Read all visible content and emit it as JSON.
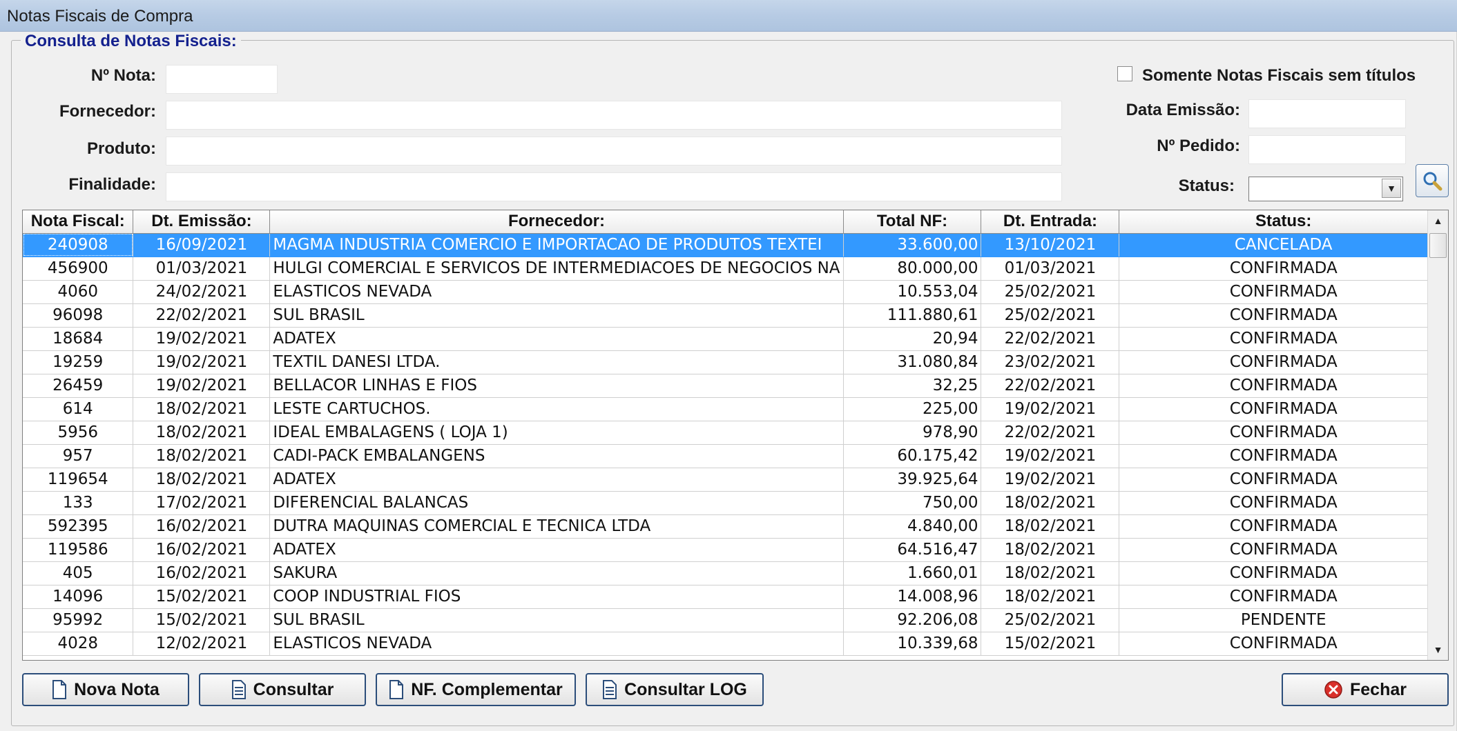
{
  "window": {
    "title": "Notas Fiscais de Compra"
  },
  "group": {
    "legend": "Consulta de Notas Fiscais:"
  },
  "filters": {
    "nota_label": "Nº Nota:",
    "fornecedor_label": "Fornecedor:",
    "produto_label": "Produto:",
    "finalidade_label": "Finalidade:",
    "somente_label": "Somente Notas Fiscais sem títulos",
    "data_emissao_label": "Data Emissão:",
    "pedido_label": "Nº Pedido:",
    "status_label": "Status:",
    "nota_value": "",
    "fornecedor_value": "",
    "produto_value": "",
    "finalidade_value": "",
    "data_emissao_value": "",
    "pedido_value": "",
    "status_value": ""
  },
  "grid": {
    "columns": [
      "Nota Fiscal:",
      "Dt. Emissão:",
      "Fornecedor:",
      "Total NF:",
      "Dt. Entrada:",
      "Status:"
    ],
    "rows": [
      [
        "240908",
        "16/09/2021",
        "MAGMA INDUSTRIA COMERCIO E IMPORTACAO DE PRODUTOS TEXTEI",
        "33.600,00",
        "13/10/2021",
        "CANCELADA"
      ],
      [
        "456900",
        "01/03/2021",
        "HULGI COMERCIAL E SERVICOS DE INTERMEDIACOES DE NEGOCIOS NA",
        "80.000,00",
        "01/03/2021",
        "CONFIRMADA"
      ],
      [
        "4060",
        "24/02/2021",
        "ELASTICOS NEVADA",
        "10.553,04",
        "25/02/2021",
        "CONFIRMADA"
      ],
      [
        "96098",
        "22/02/2021",
        "SUL BRASIL",
        "111.880,61",
        "25/02/2021",
        "CONFIRMADA"
      ],
      [
        "18684",
        "19/02/2021",
        "ADATEX",
        "20,94",
        "22/02/2021",
        "CONFIRMADA"
      ],
      [
        "19259",
        "19/02/2021",
        "TEXTIL DANESI LTDA.",
        "31.080,84",
        "23/02/2021",
        "CONFIRMADA"
      ],
      [
        "26459",
        "19/02/2021",
        "BELLACOR LINHAS E FIOS",
        "32,25",
        "22/02/2021",
        "CONFIRMADA"
      ],
      [
        "614",
        "18/02/2021",
        "LESTE CARTUCHOS.",
        "225,00",
        "19/02/2021",
        "CONFIRMADA"
      ],
      [
        "5956",
        "18/02/2021",
        "IDEAL EMBALAGENS ( LOJA 1)",
        "978,90",
        "22/02/2021",
        "CONFIRMADA"
      ],
      [
        "957",
        "18/02/2021",
        "CADI-PACK EMBALANGENS",
        "60.175,42",
        "19/02/2021",
        "CONFIRMADA"
      ],
      [
        "119654",
        "18/02/2021",
        "ADATEX",
        "39.925,64",
        "19/02/2021",
        "CONFIRMADA"
      ],
      [
        "133",
        "17/02/2021",
        "DIFERENCIAL BALANCAS",
        "750,00",
        "18/02/2021",
        "CONFIRMADA"
      ],
      [
        "592395",
        "16/02/2021",
        "DUTRA MAQUINAS COMERCIAL E TECNICA LTDA",
        "4.840,00",
        "18/02/2021",
        "CONFIRMADA"
      ],
      [
        "119586",
        "16/02/2021",
        "ADATEX",
        "64.516,47",
        "18/02/2021",
        "CONFIRMADA"
      ],
      [
        "405",
        "16/02/2021",
        "SAKURA",
        "1.660,01",
        "18/02/2021",
        "CONFIRMADA"
      ],
      [
        "14096",
        "15/02/2021",
        "COOP INDUSTRIAL FIOS",
        "14.008,96",
        "18/02/2021",
        "CONFIRMADA"
      ],
      [
        "95992",
        "15/02/2021",
        "SUL BRASIL",
        "92.206,08",
        "25/02/2021",
        "PENDENTE"
      ],
      [
        "4028",
        "12/02/2021",
        "ELASTICOS NEVADA",
        "10.339,68",
        "15/02/2021",
        "CONFIRMADA"
      ]
    ]
  },
  "buttons": {
    "nova_nota": "Nova Nota",
    "consultar": "Consultar",
    "nf_complementar": "NF. Complementar",
    "consultar_log": "Consultar LOG",
    "fechar": "Fechar"
  }
}
